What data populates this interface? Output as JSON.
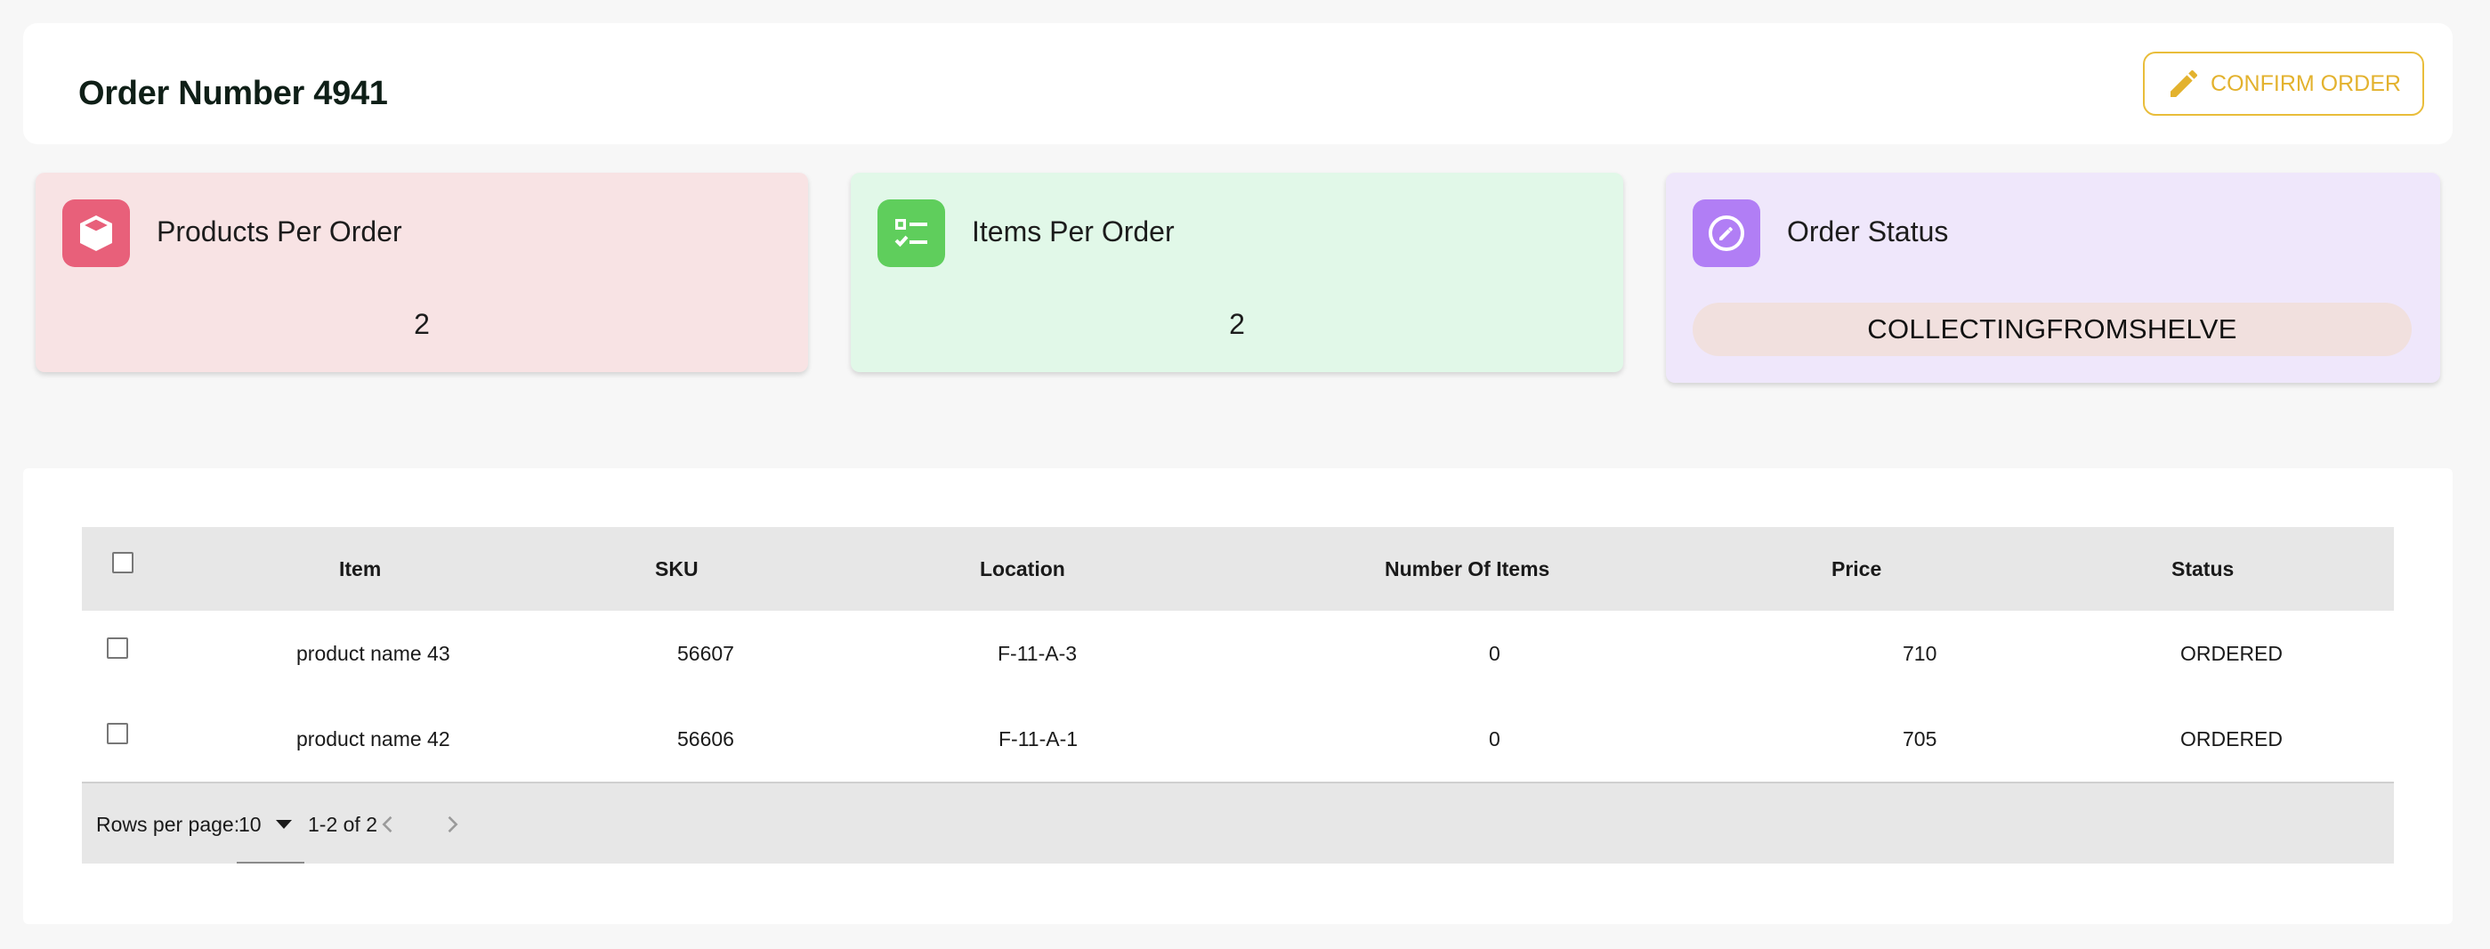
{
  "header": {
    "title": "Order Number 4941",
    "confirm_label": "CONFIRM ORDER",
    "confirm_icon": "pencil-icon"
  },
  "stats": {
    "products": {
      "label": "Products Per Order",
      "value": "2",
      "icon": "box-icon",
      "icon_color": "#e8607a"
    },
    "items": {
      "label": "Items Per Order",
      "value": "2",
      "icon": "checklist-icon",
      "icon_color": "#5fce5c"
    },
    "status": {
      "label": "Order Status",
      "value": "COLLECTINGFROMSHELVE",
      "icon": "edit-circle-icon",
      "icon_color": "#b17ef5"
    }
  },
  "table": {
    "columns": [
      "Item",
      "SKU",
      "Location",
      "Number Of Items",
      "Price",
      "Status"
    ],
    "rows": [
      [
        "product name 43",
        "56607",
        "F-11-A-3",
        "0",
        "710",
        "ORDERED"
      ],
      [
        "product name 42",
        "56606",
        "F-11-A-1",
        "0",
        "705",
        "ORDERED"
      ]
    ],
    "footer": {
      "rows_per_page_label": "Rows per page:",
      "rows_per_page_value": "10",
      "range": "1-2 of 2"
    }
  },
  "colors": {
    "accent": "#e3b22e",
    "products_bg": "#f8e3e4",
    "items_bg": "#e1f8e8",
    "status_bg": "#efe7fb",
    "status_pill": "#f1e0de"
  }
}
